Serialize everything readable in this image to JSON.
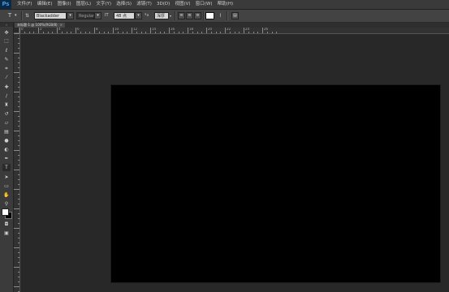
{
  "app": {
    "logo": "Ps"
  },
  "menu": {
    "items": [
      {
        "label": "文件(F)"
      },
      {
        "label": "编辑(E)"
      },
      {
        "label": "图像(I)"
      },
      {
        "label": "图层(L)"
      },
      {
        "label": "文字(Y)"
      },
      {
        "label": "选择(S)"
      },
      {
        "label": "滤镜(T)"
      },
      {
        "label": "3D(D)"
      },
      {
        "label": "视图(V)"
      },
      {
        "label": "窗口(W)"
      },
      {
        "label": "帮助(H)"
      }
    ]
  },
  "options": {
    "tool_icon": "T",
    "orientation_icon": "IT",
    "font_family": "Blackadder ITC",
    "font_style": "Regular",
    "font_size": "48 点",
    "anti_alias": "浑厚",
    "text_color": "#ffffff"
  },
  "document": {
    "tab_title": "未标题-1 @ 100%(RGB/8)",
    "close_glyph": "×",
    "canvas_color": "#000000"
  },
  "ruler": {
    "h_labels": [
      "0",
      "2",
      "4",
      "6",
      "8",
      "10",
      "12",
      "14",
      "16",
      "18",
      "20",
      "22",
      "24",
      "26"
    ]
  },
  "tools": [
    {
      "name": "move-tool-icon",
      "glyph": "✥"
    },
    {
      "name": "marquee-tool-icon",
      "glyph": "⬚"
    },
    {
      "name": "lasso-tool-icon",
      "glyph": "ℓ"
    },
    {
      "name": "quick-select-tool-icon",
      "glyph": "✎"
    },
    {
      "name": "crop-tool-icon",
      "glyph": "⌗"
    },
    {
      "name": "eyedropper-tool-icon",
      "glyph": "⁄"
    },
    {
      "name": "healing-brush-tool-icon",
      "glyph": "✚"
    },
    {
      "name": "brush-tool-icon",
      "glyph": "∕"
    },
    {
      "name": "clone-stamp-tool-icon",
      "glyph": "♜"
    },
    {
      "name": "history-brush-tool-icon",
      "glyph": "↺"
    },
    {
      "name": "eraser-tool-icon",
      "glyph": "▱"
    },
    {
      "name": "gradient-tool-icon",
      "glyph": "▤"
    },
    {
      "name": "blur-tool-icon",
      "glyph": "●"
    },
    {
      "name": "dodge-tool-icon",
      "glyph": "◐"
    },
    {
      "name": "pen-tool-icon",
      "glyph": "✒"
    },
    {
      "name": "type-tool-icon",
      "glyph": "T"
    },
    {
      "name": "path-select-tool-icon",
      "glyph": "➤"
    },
    {
      "name": "shape-tool-icon",
      "glyph": "▭"
    },
    {
      "name": "hand-tool-icon",
      "glyph": "✋"
    },
    {
      "name": "zoom-tool-icon",
      "glyph": "⚲"
    }
  ],
  "swatches": {
    "foreground": "#ffffff",
    "background": "#000000"
  }
}
